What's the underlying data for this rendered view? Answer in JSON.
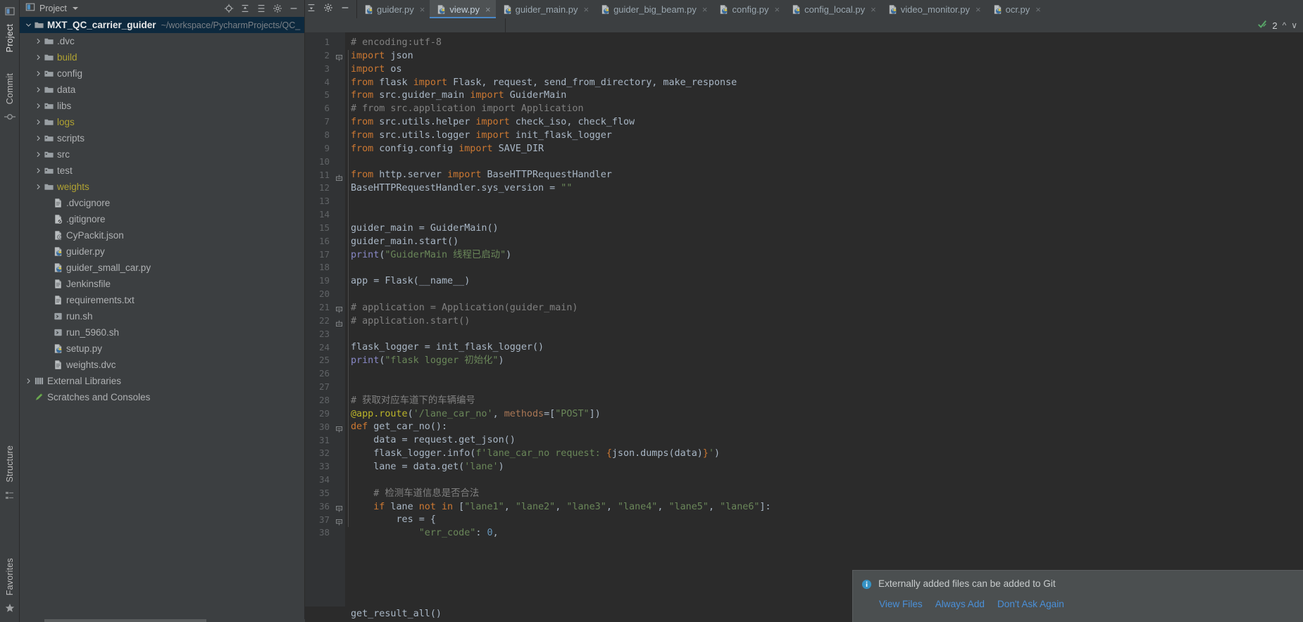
{
  "rail": {
    "project_label": "Project",
    "commit_label": "Commit",
    "structure_label": "Structure",
    "favorites_label": "Favorites",
    "icons": {
      "project": "project-icon",
      "commit": "commit-icon",
      "structure": "structure-icon",
      "favorites": "star-icon"
    }
  },
  "panel": {
    "title": "Project",
    "dropdown_icon": "chevron-down-icon",
    "actions": [
      {
        "name": "locate-icon"
      },
      {
        "name": "expand-all-icon"
      },
      {
        "name": "collapse-all-icon"
      },
      {
        "name": "settings-gear-icon"
      },
      {
        "name": "hide-icon"
      }
    ]
  },
  "tree": [
    {
      "label": "MXT_QC_carrier_guider",
      "path": "~/workspace/PycharmProjects/QC_",
      "icon": "folder-icon",
      "depth": 0,
      "arrow": "expanded",
      "color": "plain",
      "selected": true
    },
    {
      "label": ".dvc",
      "icon": "folder-icon",
      "depth": 1,
      "arrow": "collapsed",
      "color": "plain",
      "selected": false
    },
    {
      "label": "build",
      "icon": "folder-icon",
      "depth": 1,
      "arrow": "collapsed",
      "color": "yellow",
      "selected": false
    },
    {
      "label": "config",
      "icon": "folder-source-icon",
      "depth": 1,
      "arrow": "collapsed",
      "color": "plain",
      "selected": false
    },
    {
      "label": "data",
      "icon": "folder-icon",
      "depth": 1,
      "arrow": "collapsed",
      "color": "plain",
      "selected": false
    },
    {
      "label": "libs",
      "icon": "folder-source-icon",
      "depth": 1,
      "arrow": "collapsed",
      "color": "plain",
      "selected": false
    },
    {
      "label": "logs",
      "icon": "folder-icon",
      "depth": 1,
      "arrow": "collapsed",
      "color": "yellow",
      "selected": false
    },
    {
      "label": "scripts",
      "icon": "folder-source-icon",
      "depth": 1,
      "arrow": "collapsed",
      "color": "plain",
      "selected": false
    },
    {
      "label": "src",
      "icon": "folder-source-icon",
      "depth": 1,
      "arrow": "collapsed",
      "color": "plain",
      "selected": false
    },
    {
      "label": "test",
      "icon": "folder-source-icon",
      "depth": 1,
      "arrow": "collapsed",
      "color": "plain",
      "selected": false
    },
    {
      "label": "weights",
      "icon": "folder-icon",
      "depth": 1,
      "arrow": "collapsed",
      "color": "yellow",
      "selected": false
    },
    {
      "label": ".dvcignore",
      "icon": "text-file-icon",
      "depth": 2,
      "arrow": "none",
      "color": "plain",
      "selected": false
    },
    {
      "label": ".gitignore",
      "icon": "gitignore-file-icon",
      "depth": 2,
      "arrow": "none",
      "color": "plain",
      "selected": false
    },
    {
      "label": "CyPackit.json",
      "icon": "json-file-icon",
      "depth": 2,
      "arrow": "none",
      "color": "plain",
      "selected": false
    },
    {
      "label": "guider.py",
      "icon": "python-file-icon",
      "depth": 2,
      "arrow": "none",
      "color": "plain",
      "selected": false
    },
    {
      "label": "guider_small_car.py",
      "icon": "python-file-icon",
      "depth": 2,
      "arrow": "none",
      "color": "plain",
      "selected": false
    },
    {
      "label": "Jenkinsfile",
      "icon": "text-file-icon",
      "depth": 2,
      "arrow": "none",
      "color": "plain",
      "selected": false
    },
    {
      "label": "requirements.txt",
      "icon": "text-file-icon",
      "depth": 2,
      "arrow": "none",
      "color": "plain",
      "selected": false
    },
    {
      "label": "run.sh",
      "icon": "shell-script-icon",
      "depth": 2,
      "arrow": "none",
      "color": "plain",
      "selected": false
    },
    {
      "label": "run_5960.sh",
      "icon": "shell-script-icon",
      "depth": 2,
      "arrow": "none",
      "color": "plain",
      "selected": false
    },
    {
      "label": "setup.py",
      "icon": "python-file-icon",
      "depth": 2,
      "arrow": "none",
      "color": "plain",
      "selected": false
    },
    {
      "label": "weights.dvc",
      "icon": "text-file-icon",
      "depth": 2,
      "arrow": "none",
      "color": "plain",
      "selected": false
    },
    {
      "label": "External Libraries",
      "icon": "library-icon",
      "depth": 0,
      "arrow": "collapsed",
      "color": "plain",
      "selected": false
    },
    {
      "label": "Scratches and Consoles",
      "icon": "scratches-icon",
      "depth": 0,
      "arrow": "none",
      "color": "plain",
      "selected": false
    }
  ],
  "tabs": [
    {
      "label": "guider.py",
      "icon": "python-file-icon",
      "active": false
    },
    {
      "label": "view.py",
      "icon": "python-file-icon",
      "active": true
    },
    {
      "label": "guider_main.py",
      "icon": "python-file-icon",
      "active": false
    },
    {
      "label": "guider_big_beam.py",
      "icon": "python-file-icon",
      "active": false
    },
    {
      "label": "config.py",
      "icon": "python-file-icon",
      "active": false
    },
    {
      "label": "config_local.py",
      "icon": "python-file-icon",
      "active": false
    },
    {
      "label": "video_monitor.py",
      "icon": "python-file-icon",
      "active": false
    },
    {
      "label": "ocr.py",
      "icon": "python-file-icon",
      "active": false
    }
  ],
  "tab_tools": [
    {
      "name": "collapse-icon"
    },
    {
      "name": "settings-gear-icon"
    },
    {
      "name": "minimize-icon"
    }
  ],
  "inspection": {
    "count": "2",
    "icon": "inspection-ok-icon",
    "up_icon": "chevron-up-icon",
    "down_icon": "chevron-down-icon"
  },
  "editor": {
    "first_line": 1,
    "lines": [
      {
        "n": 1,
        "fold": "none",
        "tokens": [
          {
            "t": "# encoding:utf-8",
            "c": "cmt"
          }
        ]
      },
      {
        "n": 2,
        "fold": "start",
        "tokens": [
          {
            "t": "import",
            "c": "kw"
          },
          {
            "t": " json",
            "c": "id"
          }
        ]
      },
      {
        "n": 3,
        "fold": "none",
        "tokens": [
          {
            "t": "import",
            "c": "kw"
          },
          {
            "t": " os",
            "c": "id"
          }
        ]
      },
      {
        "n": 4,
        "fold": "none",
        "tokens": [
          {
            "t": "from",
            "c": "kw"
          },
          {
            "t": " flask ",
            "c": "id"
          },
          {
            "t": "import",
            "c": "kw"
          },
          {
            "t": " Flask, request, send_from_directory, make_response",
            "c": "id"
          }
        ]
      },
      {
        "n": 5,
        "fold": "none",
        "tokens": [
          {
            "t": "from",
            "c": "kw"
          },
          {
            "t": " src.guider_main ",
            "c": "id"
          },
          {
            "t": "import",
            "c": "kw"
          },
          {
            "t": " GuiderMain",
            "c": "id"
          }
        ]
      },
      {
        "n": 6,
        "fold": "none",
        "tokens": [
          {
            "t": "# from src.application import Application",
            "c": "cmt"
          }
        ]
      },
      {
        "n": 7,
        "fold": "none",
        "tokens": [
          {
            "t": "from",
            "c": "kw"
          },
          {
            "t": " src.utils.helper ",
            "c": "id"
          },
          {
            "t": "import",
            "c": "kw"
          },
          {
            "t": " check_iso, check_flow",
            "c": "id"
          }
        ]
      },
      {
        "n": 8,
        "fold": "none",
        "tokens": [
          {
            "t": "from",
            "c": "kw"
          },
          {
            "t": " src.utils.logger ",
            "c": "id"
          },
          {
            "t": "import",
            "c": "kw"
          },
          {
            "t": " init_flask_logger",
            "c": "id"
          }
        ]
      },
      {
        "n": 9,
        "fold": "none",
        "tokens": [
          {
            "t": "from",
            "c": "kw"
          },
          {
            "t": " config.config ",
            "c": "id"
          },
          {
            "t": "import",
            "c": "kw"
          },
          {
            "t": " SAVE_DIR",
            "c": "id"
          }
        ]
      },
      {
        "n": 10,
        "fold": "none",
        "tokens": []
      },
      {
        "n": 11,
        "fold": "end",
        "tokens": [
          {
            "t": "from",
            "c": "kw"
          },
          {
            "t": " http.server ",
            "c": "id"
          },
          {
            "t": "import",
            "c": "kw"
          },
          {
            "t": " BaseHTTPRequestHandler",
            "c": "id"
          }
        ]
      },
      {
        "n": 12,
        "fold": "none",
        "tokens": [
          {
            "t": "BaseHTTPRequestHandler.sys_version = ",
            "c": "id"
          },
          {
            "t": "\"\"",
            "c": "str"
          }
        ]
      },
      {
        "n": 13,
        "fold": "none",
        "tokens": []
      },
      {
        "n": 14,
        "fold": "none",
        "tokens": []
      },
      {
        "n": 15,
        "fold": "none",
        "tokens": [
          {
            "t": "guider_main = GuiderMain()",
            "c": "id"
          }
        ]
      },
      {
        "n": 16,
        "fold": "none",
        "tokens": [
          {
            "t": "guider_main.start()",
            "c": "id"
          }
        ]
      },
      {
        "n": 17,
        "fold": "none",
        "tokens": [
          {
            "t": "print",
            "c": "bi"
          },
          {
            "t": "(",
            "c": "id"
          },
          {
            "t": "\"GuiderMain 线程已启动\"",
            "c": "str"
          },
          {
            "t": ")",
            "c": "id"
          }
        ]
      },
      {
        "n": 18,
        "fold": "none",
        "tokens": []
      },
      {
        "n": 19,
        "fold": "none",
        "tokens": [
          {
            "t": "app = Flask(__name__)",
            "c": "id"
          }
        ]
      },
      {
        "n": 20,
        "fold": "none",
        "tokens": []
      },
      {
        "n": 21,
        "fold": "start",
        "tokens": [
          {
            "t": "# application = Application(guider_main)",
            "c": "cmt"
          }
        ]
      },
      {
        "n": 22,
        "fold": "end",
        "tokens": [
          {
            "t": "# application.start()",
            "c": "cmt"
          }
        ]
      },
      {
        "n": 23,
        "fold": "none",
        "tokens": []
      },
      {
        "n": 24,
        "fold": "none",
        "tokens": [
          {
            "t": "flask_logger = init_flask_logger()",
            "c": "id"
          }
        ]
      },
      {
        "n": 25,
        "fold": "none",
        "tokens": [
          {
            "t": "print",
            "c": "bi"
          },
          {
            "t": "(",
            "c": "id"
          },
          {
            "t": "\"flask logger 初始化\"",
            "c": "str"
          },
          {
            "t": ")",
            "c": "id"
          }
        ]
      },
      {
        "n": 26,
        "fold": "none",
        "tokens": []
      },
      {
        "n": 27,
        "fold": "none",
        "tokens": []
      },
      {
        "n": 28,
        "fold": "none",
        "tokens": [
          {
            "t": "# 获取对应车道下的车辆编号",
            "c": "cmt"
          }
        ]
      },
      {
        "n": 29,
        "fold": "none",
        "tokens": [
          {
            "t": "@app.route",
            "c": "dec"
          },
          {
            "t": "(",
            "c": "id"
          },
          {
            "t": "'/lane_car_no'",
            "c": "str"
          },
          {
            "t": ", ",
            "c": "id"
          },
          {
            "t": "methods",
            "c": "kwarg"
          },
          {
            "t": "=[",
            "c": "id"
          },
          {
            "t": "\"POST\"",
            "c": "str"
          },
          {
            "t": "])",
            "c": "id"
          }
        ]
      },
      {
        "n": 30,
        "fold": "start",
        "tokens": [
          {
            "t": "def",
            "c": "kw"
          },
          {
            "t": " get_car_no():",
            "c": "id"
          }
        ]
      },
      {
        "n": 31,
        "fold": "none",
        "tokens": [
          {
            "t": "    data = request.get_json()",
            "c": "id"
          }
        ]
      },
      {
        "n": 32,
        "fold": "none",
        "tokens": [
          {
            "t": "    flask_logger.info(",
            "c": "id"
          },
          {
            "t": "f'lane_car_no request: ",
            "c": "str"
          },
          {
            "t": "{",
            "c": "brace"
          },
          {
            "t": "json.dumps(data)",
            "c": "id"
          },
          {
            "t": "}",
            "c": "brace"
          },
          {
            "t": "'",
            "c": "str"
          },
          {
            "t": ")",
            "c": "id"
          }
        ]
      },
      {
        "n": 33,
        "fold": "none",
        "tokens": [
          {
            "t": "    lane = data.get(",
            "c": "id"
          },
          {
            "t": "'lane'",
            "c": "str"
          },
          {
            "t": ")",
            "c": "id"
          }
        ]
      },
      {
        "n": 34,
        "fold": "none",
        "tokens": []
      },
      {
        "n": 35,
        "fold": "none",
        "tokens": [
          {
            "t": "    ",
            "c": "id"
          },
          {
            "t": "# 检测车道信息是否合法",
            "c": "cmt"
          }
        ]
      },
      {
        "n": 36,
        "fold": "start2",
        "tokens": [
          {
            "t": "    ",
            "c": "id"
          },
          {
            "t": "if",
            "c": "kw"
          },
          {
            "t": " lane ",
            "c": "id"
          },
          {
            "t": "not in",
            "c": "kw"
          },
          {
            "t": " [",
            "c": "id"
          },
          {
            "t": "\"lane1\"",
            "c": "str"
          },
          {
            "t": ", ",
            "c": "id"
          },
          {
            "t": "\"lane2\"",
            "c": "str"
          },
          {
            "t": ", ",
            "c": "id"
          },
          {
            "t": "\"lane3\"",
            "c": "str"
          },
          {
            "t": ", ",
            "c": "id"
          },
          {
            "t": "\"lane4\"",
            "c": "str"
          },
          {
            "t": ", ",
            "c": "id"
          },
          {
            "t": "\"lane5\"",
            "c": "str"
          },
          {
            "t": ", ",
            "c": "id"
          },
          {
            "t": "\"lane6\"",
            "c": "str"
          },
          {
            "t": "]:",
            "c": "id"
          }
        ]
      },
      {
        "n": 37,
        "fold": "start2",
        "tokens": [
          {
            "t": "        res = {",
            "c": "id"
          }
        ]
      },
      {
        "n": 38,
        "fold": "none",
        "tokens": [
          {
            "t": "            ",
            "c": "id"
          },
          {
            "t": "\"err_code\"",
            "c": "str"
          },
          {
            "t": ": ",
            "c": "id"
          },
          {
            "t": "0",
            "c": "num"
          },
          {
            "t": ",",
            "c": "id"
          }
        ]
      }
    ],
    "bottom_preview": "get_result_all()"
  },
  "notification": {
    "icon": "info-icon",
    "message": "Externally added files can be added to Git",
    "actions": [
      "View Files",
      "Always Add",
      "Don't Ask Again"
    ]
  },
  "colors": {
    "accent_blue": "#4a88c7",
    "link_blue": "#4a90d9",
    "selection_blue": "#0d293e",
    "panel_bg": "#3c3f41",
    "editor_bg": "#2b2b2b",
    "gutter_bg": "#313335",
    "keyword": "#cc7832",
    "string": "#6a8759",
    "comment": "#808080",
    "identifier": "#a9b7c6",
    "number": "#6897bb",
    "decorator": "#bbb529",
    "builtin": "#8888c6"
  }
}
